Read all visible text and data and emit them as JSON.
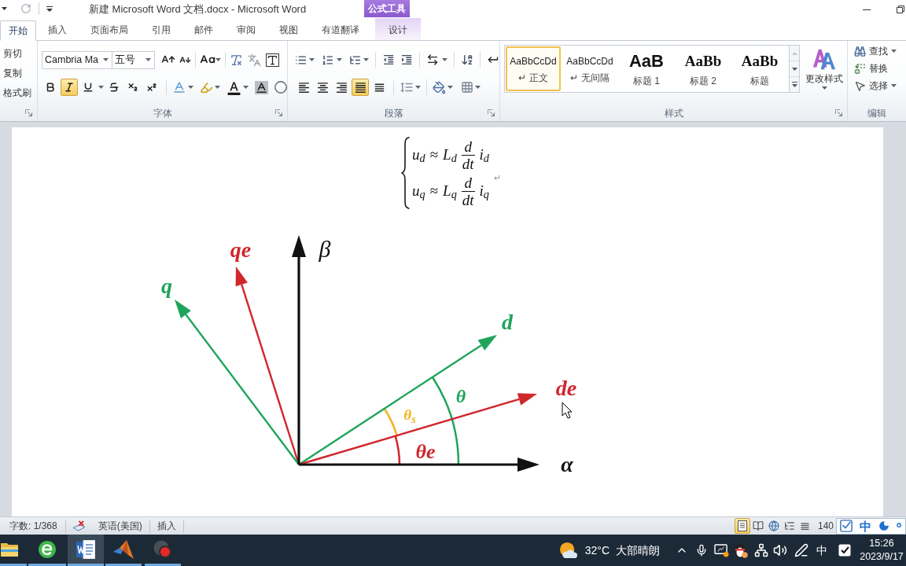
{
  "window": {
    "title": "新建 Microsoft Word 文档.docx - Microsoft Word",
    "context_group": "公式工具"
  },
  "tabs": [
    {
      "label": "开始",
      "selected": true,
      "kind": "main"
    },
    {
      "label": "插入",
      "selected": false,
      "kind": "main"
    },
    {
      "label": "页面布局",
      "selected": false,
      "kind": "main"
    },
    {
      "label": "引用",
      "selected": false,
      "kind": "main"
    },
    {
      "label": "邮件",
      "selected": false,
      "kind": "main"
    },
    {
      "label": "审阅",
      "selected": false,
      "kind": "main"
    },
    {
      "label": "视图",
      "selected": false,
      "kind": "main"
    },
    {
      "label": "有道翻译",
      "selected": false,
      "kind": "main"
    },
    {
      "label": "设计",
      "selected": false,
      "kind": "contextual"
    }
  ],
  "ribbon": {
    "clipboard": {
      "commands": [
        "剪切",
        "复制",
        "格式刷"
      ]
    },
    "font": {
      "label": "字体",
      "font_name": "Cambria Ma",
      "font_size": "五号",
      "formatting": [
        {
          "kind": "bold",
          "active": false
        },
        {
          "kind": "italic",
          "active": true
        },
        {
          "kind": "underline",
          "active": false
        },
        {
          "kind": "strikethrough",
          "active": false
        },
        {
          "kind": "subscript",
          "active": false
        },
        {
          "kind": "superscript",
          "active": false
        }
      ]
    },
    "paragraph": {
      "label": "段落",
      "alignment": [
        {
          "kind": "left",
          "active": false
        },
        {
          "kind": "center",
          "active": false
        },
        {
          "kind": "right",
          "active": false
        },
        {
          "kind": "justify",
          "active": true
        },
        {
          "kind": "distributed",
          "active": false
        }
      ]
    },
    "styles": {
      "label": "样式",
      "items": [
        {
          "sample": "AaBbCcDd",
          "name": "↵ 正文",
          "kind": "body",
          "selected": true
        },
        {
          "sample": "AaBbCcDd",
          "name": "↵ 无间隔",
          "kind": "body",
          "selected": false
        },
        {
          "sample": "AaB",
          "name": "标题 1",
          "kind": "heading1",
          "selected": false
        },
        {
          "sample": "AaBb",
          "name": "标题 2",
          "kind": "heading2",
          "selected": false
        },
        {
          "sample": "AaBb",
          "name": "标题",
          "kind": "title",
          "selected": false
        }
      ],
      "change_styles": "更改样式"
    },
    "editing": {
      "label": "编辑",
      "commands": [
        {
          "label": "查找",
          "kind": "find",
          "dropdown": true
        },
        {
          "label": "替换",
          "kind": "replace",
          "dropdown": false
        },
        {
          "label": "选择",
          "kind": "select",
          "dropdown": true
        }
      ]
    }
  },
  "document": {
    "equation": {
      "lines": [
        {
          "variable": "u$_{d}$",
          "relation": "≈",
          "inductance": "L$_{d}$",
          "numerator": "d",
          "denominator": "dt",
          "current": "i$_{d}$"
        },
        {
          "variable": "u$_{q}$",
          "relation": "≈",
          "inductance": "L$_{q}$",
          "numerator": "d",
          "denominator": "dt",
          "current": "i$_{q}$"
        }
      ]
    },
    "paragraph_mark": "↵",
    "diagram": {
      "axes": [
        {
          "label": "β"
        },
        {
          "label": "α"
        }
      ],
      "vectors": [
        {
          "label": "qe",
          "color": "#d0262c"
        },
        {
          "label": "q",
          "color": "#1fa55a"
        },
        {
          "label": "d",
          "color": "#1fa55a"
        },
        {
          "label": "de",
          "color": "#d0262c"
        }
      ],
      "angles": [
        {
          "label": "θ",
          "color": "#1fa55a"
        },
        {
          "label": "θ$_{s}$",
          "color": "#f2b31e"
        },
        {
          "label": "θe",
          "color": "#d0262c"
        }
      ]
    }
  },
  "status_bar": {
    "word_count": "字数: 1/368",
    "language": "英语(美国)",
    "input_mode": "插入",
    "views": [
      {
        "kind": "print_layout",
        "selected": true
      },
      {
        "kind": "reading",
        "selected": false
      },
      {
        "kind": "web_layout",
        "selected": false
      },
      {
        "kind": "outline",
        "selected": false
      },
      {
        "kind": "draft",
        "selected": false
      }
    ],
    "zoom": "140",
    "ime_mode": "中"
  },
  "taskbar": {
    "apps": [
      {
        "kind": "file_explorer",
        "selected": false
      },
      {
        "kind": "browser",
        "selected": false
      },
      {
        "kind": "word",
        "selected": true
      },
      {
        "kind": "matlab",
        "selected": false
      },
      {
        "kind": "recorder",
        "selected": false
      }
    ],
    "weather": {
      "temperature": "32°C",
      "condition": "大部晴朗"
    },
    "input_method": "中",
    "time": "15:26",
    "date": "2023/9/17"
  }
}
